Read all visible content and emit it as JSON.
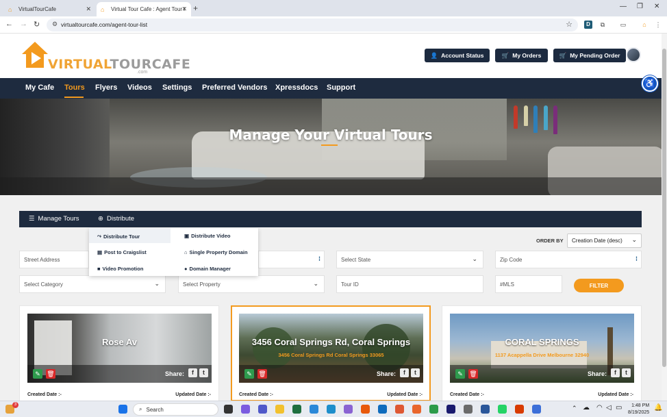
{
  "browser": {
    "tabs": [
      {
        "title": "VirtualTourCafe"
      },
      {
        "title": "Virtual Tour Cafe : Agent Tour l"
      }
    ],
    "url": "virtualtourcafe.com/agent-tour-list",
    "extension_letter": "D"
  },
  "header": {
    "logo_part1": "VIRTUAL",
    "logo_part2": "TOURCAFE",
    "logo_suffix": ".com",
    "buttons": {
      "account_status": "Account Status",
      "my_orders": "My Orders",
      "my_pending_order": "My Pending Order"
    }
  },
  "nav": {
    "items": [
      "My Cafe",
      "Tours",
      "Flyers",
      "Videos",
      "Settings",
      "Preferred Vendors",
      "Xpressdocs",
      "Support"
    ],
    "active": "Tours"
  },
  "hero": {
    "title": "Manage Your Virtual Tours"
  },
  "subnav": {
    "manage_tours": "Manage Tours",
    "distribute": "Distribute"
  },
  "distribute_menu": {
    "distribute_tour": "Distribute Tour",
    "distribute_video": "Distribute Video",
    "post_to_craigslist": "Post to Craigslist",
    "single_property_domain": "Single Property Domain",
    "video_promotion": "Video Promotion",
    "domain_manager": "Domain Manager"
  },
  "filters": {
    "order_by_label": "ORDER BY",
    "order_by_value": "Creation Date (desc)",
    "street_address": "Street Address",
    "select_state": "Select State",
    "zip_code": "Zip Code",
    "select_category": "Select Category",
    "select_property": "Select Property",
    "tour_id": "Tour ID",
    "mls": "#MLS",
    "filter_button": "FILTER"
  },
  "tours": [
    {
      "title": "Rose Av",
      "address": "",
      "share_label": "Share:",
      "created_label": "Created Date :-",
      "updated_label": "Updated Date :-"
    },
    {
      "title": "3456 Coral Springs Rd, Coral Springs",
      "address": "3456 Coral Springs Rd Coral Springs 33065",
      "share_label": "Share:",
      "created_label": "Created Date :-",
      "updated_label": "Updated Date :-"
    },
    {
      "title": "CORAL SPRINGS",
      "address": "1137 Acappella Drive Melbourne 32940",
      "share_label": "Share:",
      "created_label": "Created Date :-",
      "updated_label": "Updated Date :-"
    }
  ],
  "taskbar": {
    "search_placeholder": "Search",
    "time": "1:48 PM",
    "date": "8/19/2025",
    "notification_count": "3"
  },
  "colors": {
    "accent": "#f39a1e",
    "navy": "#1e2b3f",
    "edit_green": "#2e9a4d",
    "delete_red": "#d9292a"
  }
}
